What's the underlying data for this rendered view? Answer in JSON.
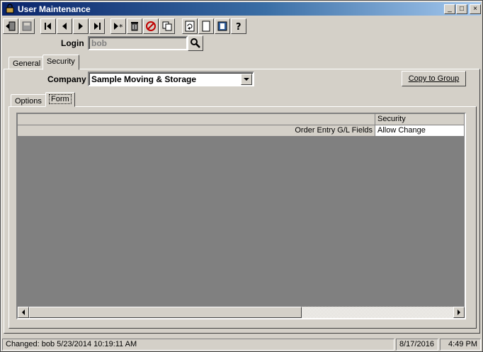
{
  "window": {
    "title": "User Maintenance"
  },
  "title_buttons": {
    "minimize": "_",
    "maximize": "□",
    "close": "×"
  },
  "toolbar": {
    "buttons": [
      "exit-icon",
      "save-icon",
      "first-record-icon",
      "previous-record-icon",
      "next-record-icon",
      "last-record-icon",
      "new-record-icon",
      "delete-icon",
      "cancel-icon",
      "copy-icon",
      "refresh-icon",
      "blank-icon",
      "notes-icon",
      "help-icon"
    ]
  },
  "login": {
    "label": "Login",
    "value": "bob"
  },
  "tabs": [
    {
      "label": "General"
    },
    {
      "label": "Security"
    }
  ],
  "security": {
    "company_label": "Company",
    "company_value": "Sample Moving & Storage",
    "copy_to_group": "Copy to Group",
    "subtabs": [
      {
        "label": "Options"
      },
      {
        "label": "Form"
      }
    ],
    "grid": {
      "columns": [
        "",
        "Security"
      ],
      "rows": [
        {
          "name": "Order Entry G/L Fields",
          "security": "Allow Change"
        }
      ]
    }
  },
  "status": {
    "changed": "Changed: bob 5/23/2014 10:19:11 AM",
    "date": "8/17/2016",
    "time": "4:49 PM"
  }
}
